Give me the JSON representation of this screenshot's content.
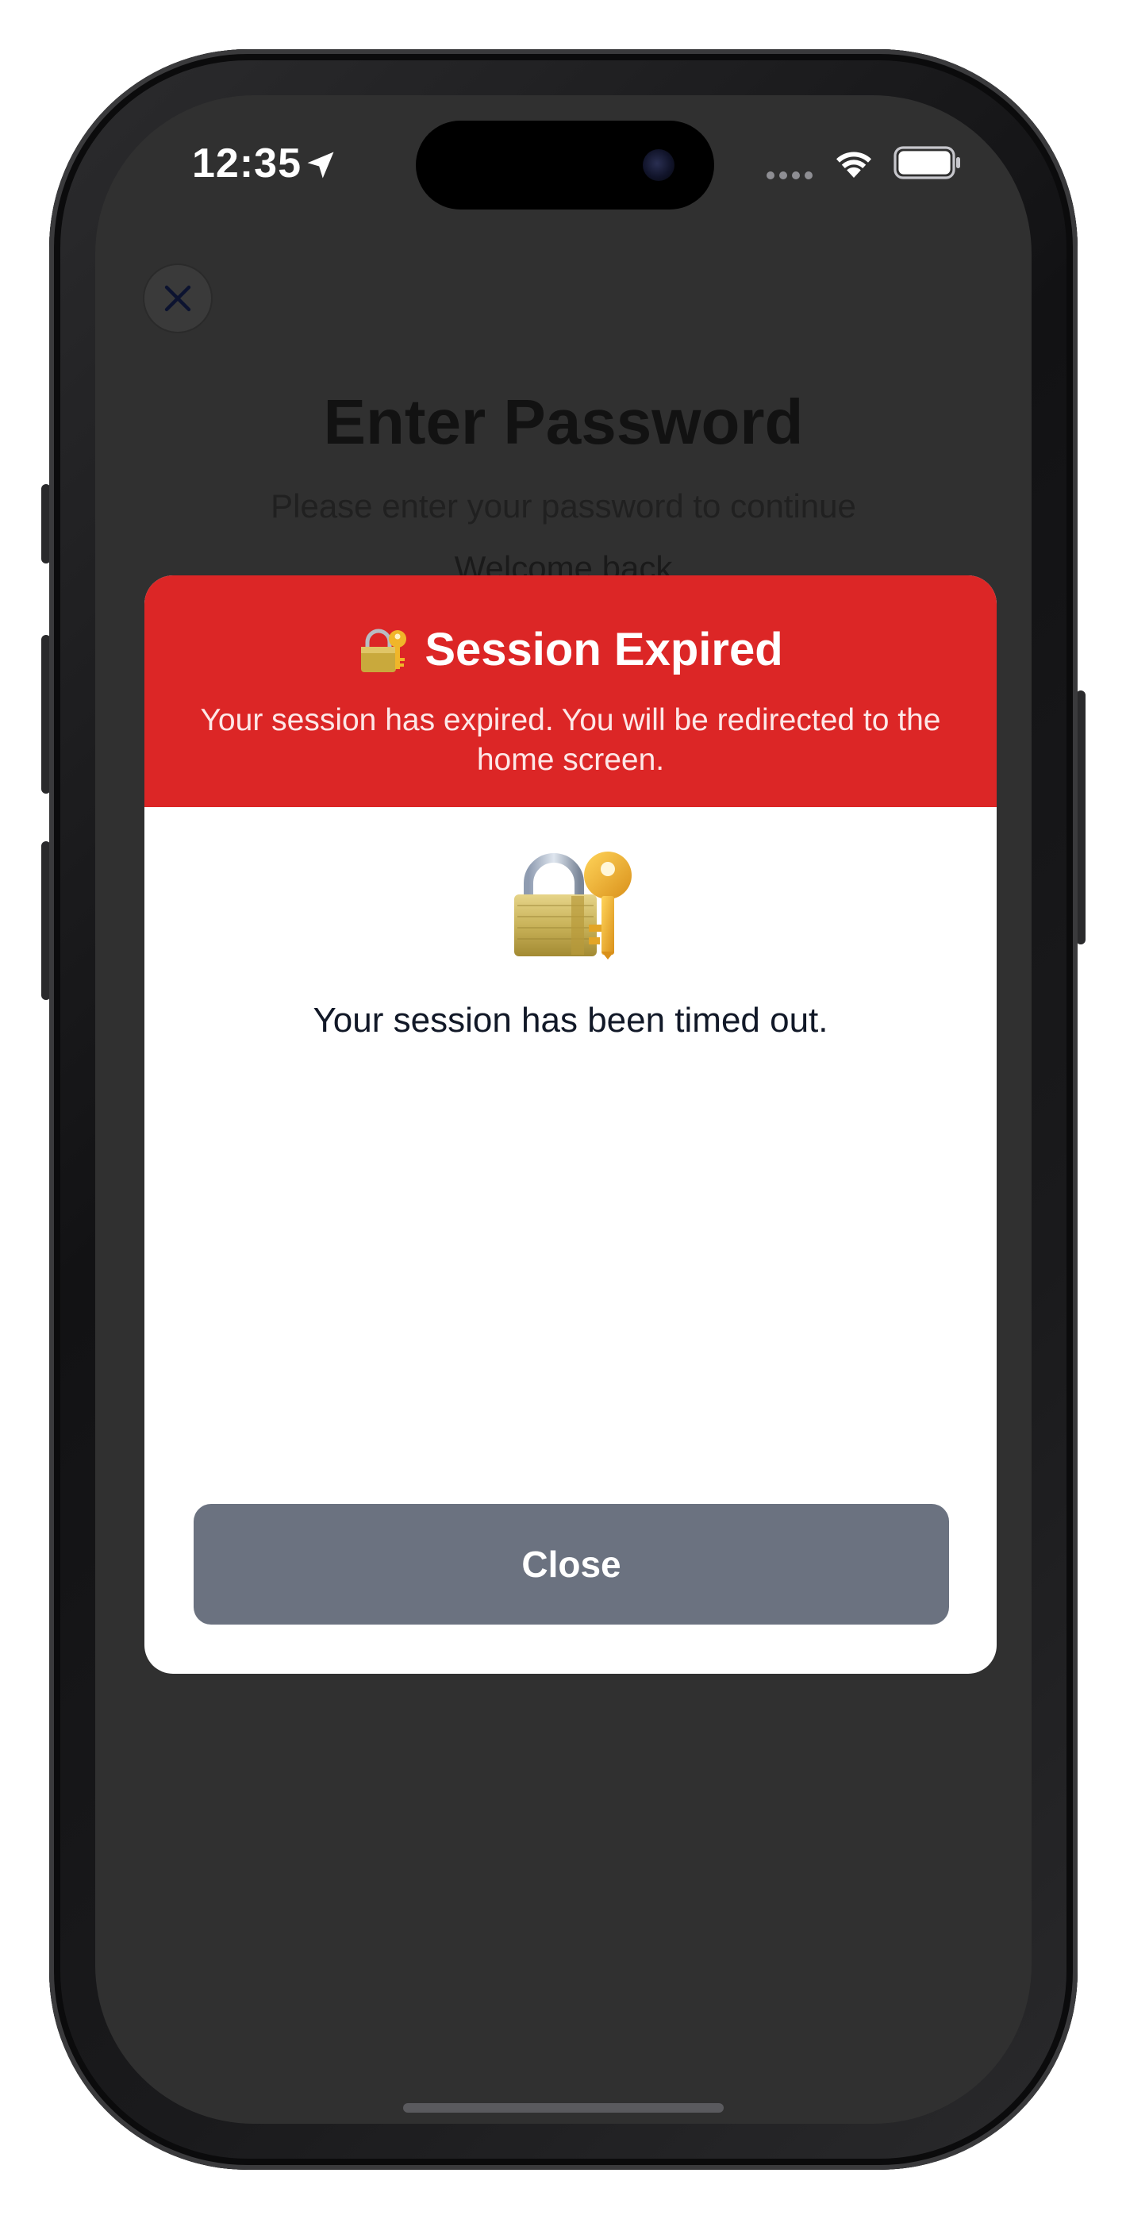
{
  "status_bar": {
    "time": "12:35",
    "icons": [
      "location-arrow-icon",
      "signal-dots-icon",
      "wifi-icon",
      "battery-icon"
    ]
  },
  "background_screen": {
    "close_icon": "close-icon",
    "title": "Enter Password",
    "subtitle": "Please enter your password to continue",
    "partial_text": "Welcome back"
  },
  "modal": {
    "header_icon": "lock-with-key-icon",
    "title": "Session Expired",
    "description": "Your session has expired. You will be redirected to the home screen.",
    "body_icon": "lock-with-key-icon",
    "message": "Your session has been timed out.",
    "close_label": "Close"
  },
  "colors": {
    "header_red": "#dc2626",
    "button_gray": "#6b7280",
    "backdrop": "#303030"
  }
}
